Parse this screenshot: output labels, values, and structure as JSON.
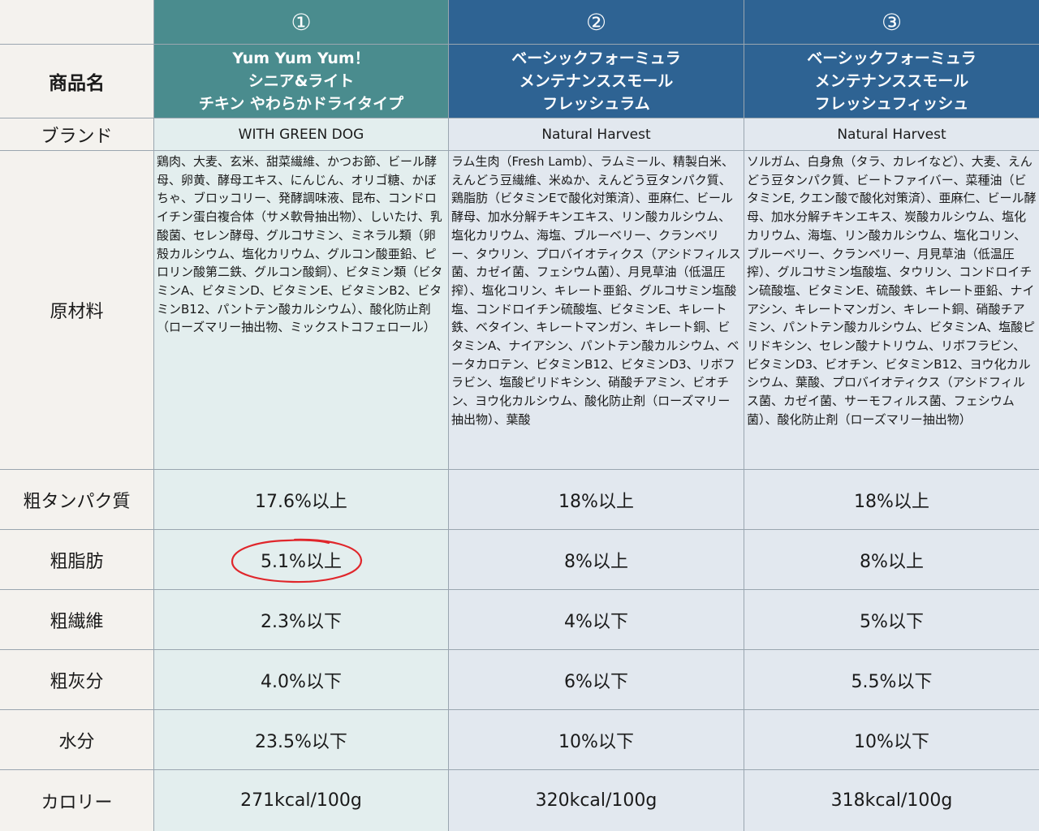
{
  "corner": "",
  "header_numbers": [
    "①",
    "②",
    "③"
  ],
  "row_labels": {
    "product_name": "商品名",
    "brand": "ブランド",
    "ingredients": "原材料",
    "protein": "粗タンパク質",
    "fat": "粗脂肪",
    "fiber": "粗繊維",
    "ash": "粗灰分",
    "moisture": "水分",
    "calorie": "カロリー"
  },
  "products": [
    {
      "name_lines": [
        "Yum Yum Yum！",
        "シニア&ライト",
        "チキン やわらかドライタイプ"
      ],
      "brand": "WITH GREEN DOG",
      "ingredients": "鶏肉、大麦、玄米、甜菜繊維、かつお節、ビール酵母、卵黄、酵母エキス、にんじん、オリゴ糖、かぼちゃ、ブロッコリー、発酵調味液、昆布、コンドロイチン蛋白複合体（サメ軟骨抽出物）、しいたけ、乳酸菌、セレン酵母、グルコサミン、ミネラル類（卵殻カルシウム、塩化カリウム、グルコン酸亜鉛、ピロリン酸第二鉄、グルコン酸銅）、ビタミン類（ビタミンA、ビタミンD、ビタミンE、ビタミンB2、ビタミンB12、パントテン酸カルシウム）、酸化防止剤（ローズマリー抽出物、ミックストコフェロール）",
      "protein": "17.6%以上",
      "fat": "5.1%以上",
      "fiber": "2.3%以下",
      "ash": "4.0%以下",
      "moisture": "23.5%以下",
      "calorie": "271kcal/100g"
    },
    {
      "name_lines": [
        "ベーシックフォーミュラ",
        "メンテナンススモール",
        "フレッシュラム"
      ],
      "brand": "Natural Harvest",
      "ingredients": "ラム生肉（Fresh Lamb）、ラムミール、精製白米、えんどう豆繊維、米ぬか、えんどう豆タンパク質、鶏脂肪（ビタミンEで酸化対策済）、亜麻仁、ビール酵母、加水分解チキンエキス、リン酸カルシウム、塩化カリウム、海塩、ブルーベリー、クランベリー、タウリン、プロバイオティクス（アシドフィルス菌、カゼイ菌、フェシウム菌）、月見草油（低温圧搾）、塩化コリン、キレート亜鉛、グルコサミン塩酸塩、コンドロイチン硫酸塩、ビタミンE、キレート鉄、ベタイン、キレートマンガン、キレート銅、ビタミンA、ナイアシン、パントテン酸カルシウム、ベータカロテン、ビタミンB12、ビタミンD3、リボフラビン、塩酸ピリドキシン、硝酸チアミン、ビオチン、ヨウ化カルシウム、酸化防止剤（ローズマリー抽出物）、葉酸",
      "protein": "18%以上",
      "fat": "8%以上",
      "fiber": "4%以下",
      "ash": "6%以下",
      "moisture": "10%以下",
      "calorie": "320kcal/100g"
    },
    {
      "name_lines": [
        "ベーシックフォーミュラ",
        "メンテナンススモール",
        "フレッシュフィッシュ"
      ],
      "brand": "Natural Harvest",
      "ingredients": "ソルガム、白身魚（タラ、カレイなど）、大麦、えんどう豆タンパク質、ビートファイバー、菜種油（ビタミンE, クエン酸で酸化対策済）、亜麻仁、ビール酵母、加水分解チキンエキス、炭酸カルシウム、塩化カリウム、海塩、リン酸カルシウム、塩化コリン、ブルーベリー、クランベリー、月見草油（低温圧搾）、グルコサミン塩酸塩、タウリン、コンドロイチン硫酸塩、ビタミンE、硫酸鉄、キレート亜鉛、ナイアシン、キレートマンガン、キレート銅、硝酸チアミン、パントテン酸カルシウム、ビタミンA、塩酸ピリドキシン、セレン酸ナトリウム、リボフラビン、ビタミンD3、ビオチン、ビタミンB12、ヨウ化カルシウム、葉酸、プロバイオティクス（アシドフィルス菌、カゼイ菌、サーモフィルス菌、フェシウム菌）、酸化防止剤（ローズマリー抽出物）",
      "protein": "18%以上",
      "fat": "8%以上",
      "fiber": "5%以下",
      "ash": "5.5%以下",
      "moisture": "10%以下",
      "calorie": "318kcal/100g"
    }
  ],
  "colors": {
    "header_teal": "#4a8c8e",
    "header_blue": "#2e6393",
    "col1_bg": "#e3eeee",
    "col23_bg": "#e2e8ef",
    "label_bg": "#f4f2ee",
    "highlight_circle": "#e0262b"
  }
}
